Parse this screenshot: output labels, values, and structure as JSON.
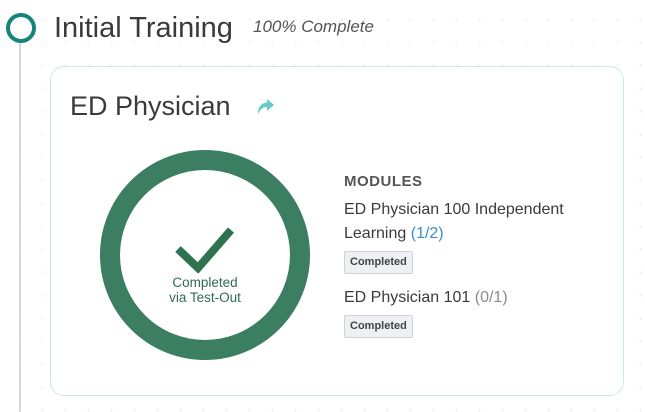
{
  "section": {
    "title": "Initial Training",
    "progress_text": "100% Complete"
  },
  "card": {
    "title": "ED Physician",
    "completion_ring": {
      "completed_fraction": 1.0,
      "label_line1": "Completed",
      "label_line2": "via Test-Out"
    },
    "modules_heading": "MODULES",
    "modules": [
      {
        "name": "ED Physician 100 Independent Learning",
        "count": "(1/2)",
        "status": "Completed"
      },
      {
        "name": "ED Physician 101",
        "count": "(0/1)",
        "status": "Completed"
      }
    ]
  },
  "icons": {
    "timeline_node": "circle-outline-icon",
    "external_link": "external-link-arrow-icon",
    "checkmark": "checkmark-icon"
  },
  "colors": {
    "accent_teal": "#15857a",
    "ring_green": "#3b7e62",
    "link_icon": "#6cc9c2",
    "count_blue": "#3d8fc4",
    "card_border": "#c7ebe3"
  }
}
